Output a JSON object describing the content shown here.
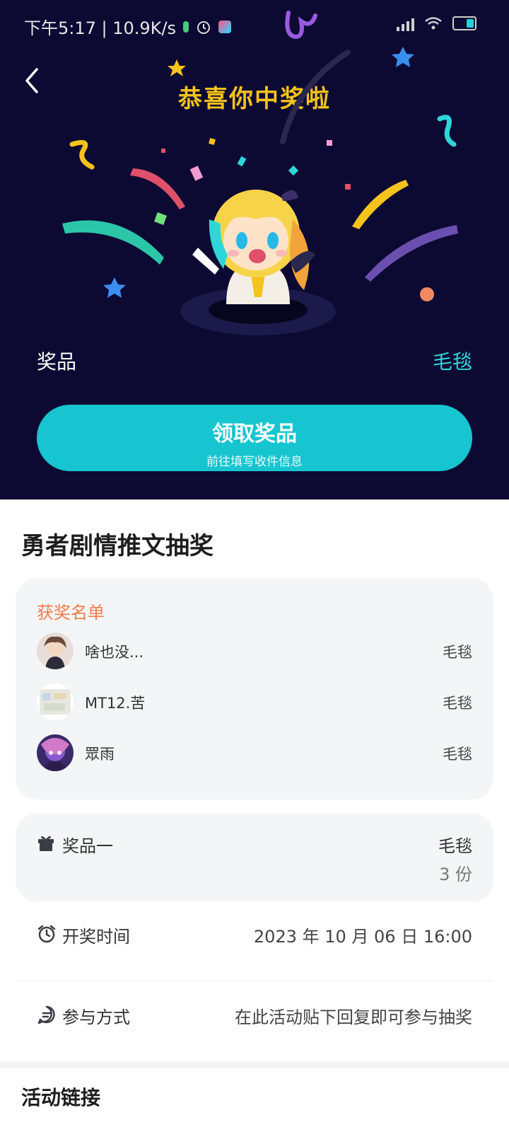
{
  "status_bar": {
    "left_text": "下午5:17 | 10.9K/s",
    "colors": {
      "text": "#e6e6e6",
      "battery_fill": "#2ad0d6"
    }
  },
  "hero": {
    "title": "恭喜你中奖啦",
    "prize_label": "奖品",
    "prize_value": "毛毯",
    "claim_button": {
      "label": "领取奖品",
      "sublabel": "前往填写收件信息"
    },
    "colors": {
      "background": "#0c0a33",
      "title": "#f6c21c",
      "accent": "#16c5cf"
    }
  },
  "event": {
    "title": "勇者剧情推文抽奖"
  },
  "winners": {
    "heading": "获奖名单",
    "items": [
      {
        "name": "啥也没...",
        "prize": "毛毯"
      },
      {
        "name": "MT12.苦",
        "prize": "毛毯"
      },
      {
        "name": "眾雨",
        "prize": "毛毯"
      }
    ]
  },
  "prize_card": {
    "label": "奖品一",
    "name": "毛毯",
    "quantity": "3 份"
  },
  "draw_time": {
    "label": "开奖时间",
    "value": "2023 年 10 月 06 日 16:00"
  },
  "participation": {
    "label": "参与方式",
    "value": "在此活动贴下回复即可参与抽奖"
  },
  "links": {
    "title": "活动链接"
  },
  "icons": {
    "back": "chevron-left-icon",
    "gift": "gift-icon",
    "alarm": "alarm-clock-icon",
    "chat": "chat-bubble-icon"
  }
}
